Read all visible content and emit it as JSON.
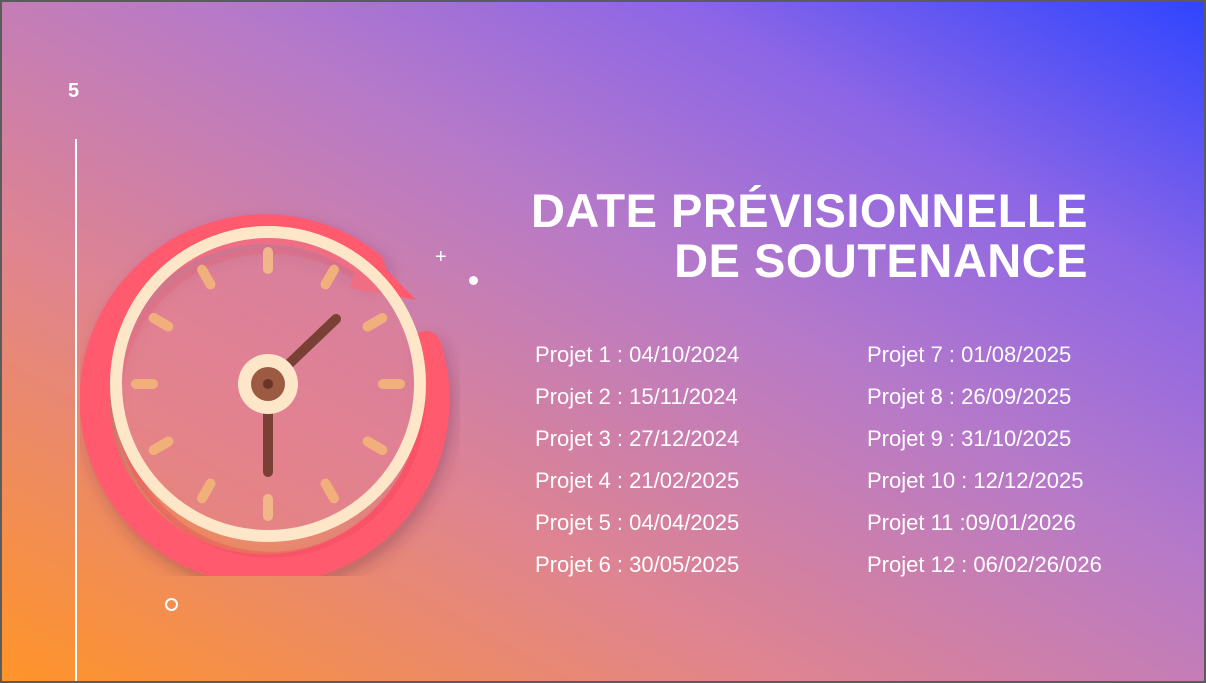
{
  "slide": {
    "number": "5",
    "title_line1": "DATE PRÉVISIONNELLE",
    "title_line2": "DE SOUTENANCE",
    "projects_left": [
      "Projet 1 : 04/10/2024",
      "Projet 2 : 15/11/2024",
      "Projet 3 : 27/12/2024",
      "Projet 4 : 21/02/2025",
      "Projet 5 : 04/04/2025",
      "Projet 6 : 30/05/2025"
    ],
    "projects_right": [
      "Projet 7 : 01/08/2025",
      "Projet 8 : 26/09/2025",
      "Projet 9 : 31/10/2025",
      "Projet 10 : 12/12/2025",
      "Projet 11 :09/01/2026",
      "Projet 12 : 06/02/26/026"
    ],
    "decor_plus": "+"
  },
  "colors": {
    "clock_ring": "#ff5a6e",
    "clock_ring_dark": "#f2455a",
    "clock_face_ring": "#fde7c8",
    "clock_hands": "#7a3f35",
    "tick_marks": "#f2b27a"
  },
  "icons": {
    "clock": "clock-refresh-icon"
  }
}
